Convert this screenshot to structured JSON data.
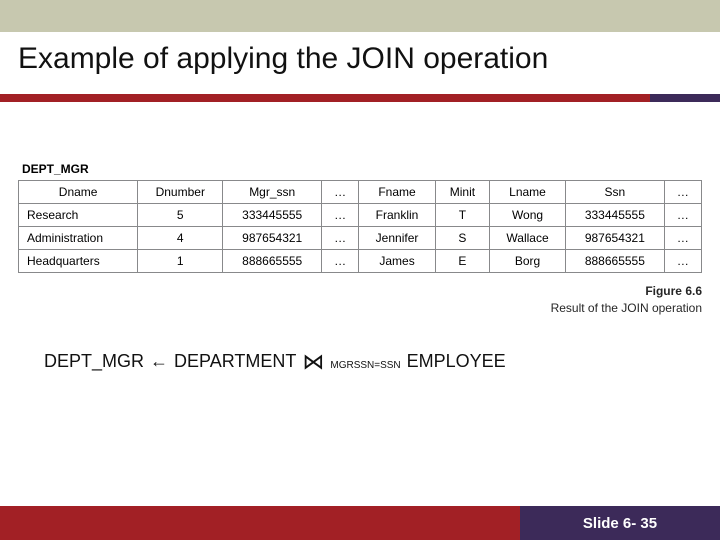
{
  "title": "Example of applying the JOIN operation",
  "table": {
    "label": "DEPT_MGR",
    "headers": [
      "Dname",
      "Dnumber",
      "Mgr_ssn",
      "…",
      "Fname",
      "Minit",
      "Lname",
      "Ssn",
      "…"
    ],
    "rows": [
      [
        "Research",
        "5",
        "333445555",
        "…",
        "Franklin",
        "T",
        "Wong",
        "333445555",
        "…"
      ],
      [
        "Administration",
        "4",
        "987654321",
        "…",
        "Jennifer",
        "S",
        "Wallace",
        "987654321",
        "…"
      ],
      [
        "Headquarters",
        "1",
        "888665555",
        "…",
        "James",
        "E",
        "Borg",
        "888665555",
        "…"
      ]
    ]
  },
  "caption": {
    "line1": "Figure 6.6",
    "line2": "Result of the JOIN operation"
  },
  "expression": {
    "result": "DEPT_MGR",
    "arrow": "←",
    "left": "DEPARTMENT",
    "bowtie": "⋈",
    "condition": "MGRSSN=SSN",
    "right": "EMPLOYEE"
  },
  "footer": {
    "slide": "Slide 6- 35"
  }
}
